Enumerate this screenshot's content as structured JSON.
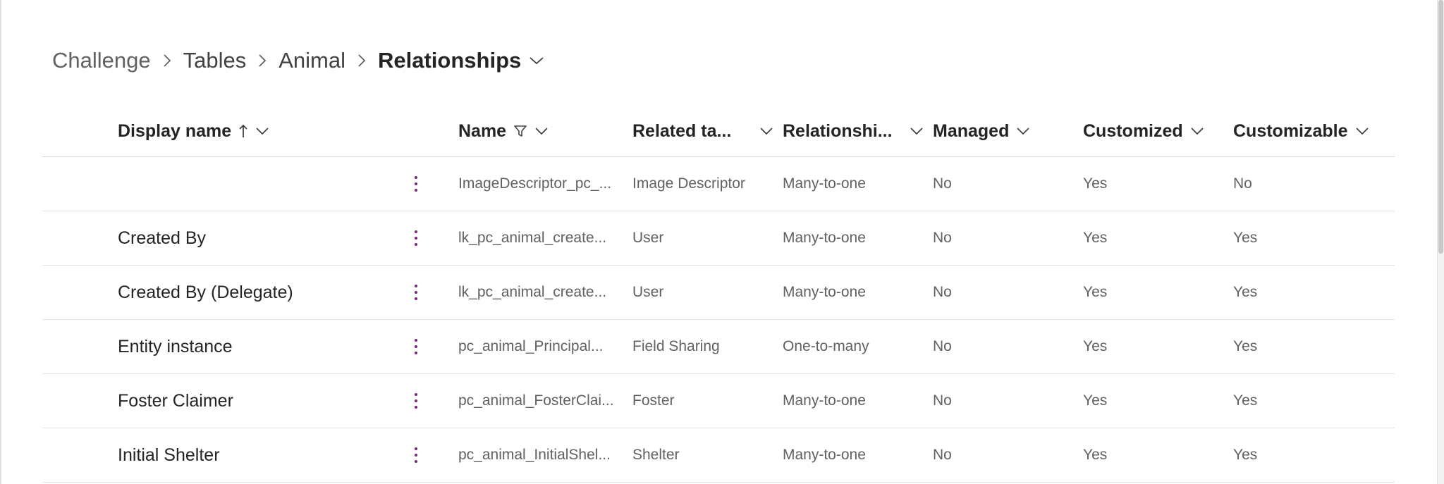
{
  "breadcrumb": {
    "items": [
      "Challenge",
      "Tables",
      "Animal",
      "Relationships"
    ]
  },
  "table": {
    "headers": {
      "display_name": "Display name",
      "name": "Name",
      "related_table": "Related ta...",
      "relationship": "Relationshi...",
      "managed": "Managed",
      "customized": "Customized",
      "customizable": "Customizable"
    },
    "sort": {
      "column": "display_name",
      "direction": "ascending",
      "icon": "arrow-up-icon"
    },
    "filter": {
      "column": "name",
      "icon": "filter-icon"
    },
    "rows": [
      {
        "display_name": "",
        "name": "ImageDescriptor_pc_...",
        "related_table": "Image Descriptor",
        "relationship": "Many-to-one",
        "managed": "No",
        "customized": "Yes",
        "customizable": "No"
      },
      {
        "display_name": "Created By",
        "name": "lk_pc_animal_create...",
        "related_table": "User",
        "relationship": "Many-to-one",
        "managed": "No",
        "customized": "Yes",
        "customizable": "Yes"
      },
      {
        "display_name": "Created By (Delegate)",
        "name": "lk_pc_animal_create...",
        "related_table": "User",
        "relationship": "Many-to-one",
        "managed": "No",
        "customized": "Yes",
        "customizable": "Yes"
      },
      {
        "display_name": "Entity instance",
        "name": "pc_animal_Principal...",
        "related_table": "Field Sharing",
        "relationship": "One-to-many",
        "managed": "No",
        "customized": "Yes",
        "customizable": "Yes"
      },
      {
        "display_name": "Foster Claimer",
        "name": "pc_animal_FosterClai...",
        "related_table": "Foster",
        "relationship": "Many-to-one",
        "managed": "No",
        "customized": "Yes",
        "customizable": "Yes"
      },
      {
        "display_name": "Initial Shelter",
        "name": "pc_animal_InitialShel...",
        "related_table": "Shelter",
        "relationship": "Many-to-one",
        "managed": "No",
        "customized": "Yes",
        "customizable": "Yes"
      }
    ]
  },
  "colors": {
    "accent": "#742774",
    "text_primary": "#242424",
    "text_secondary": "#616161",
    "divider": "#e3e3e3"
  }
}
